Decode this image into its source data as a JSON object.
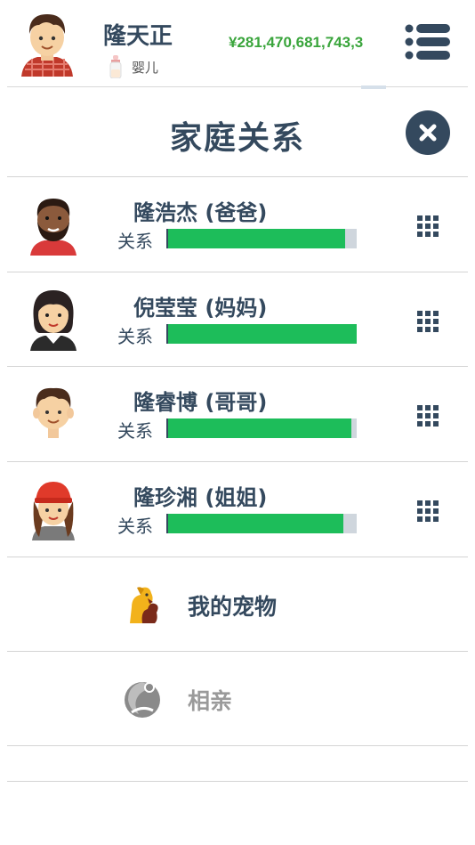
{
  "player": {
    "name": "隆天正",
    "stage": "婴儿",
    "money": "¥281,470,681,743,3"
  },
  "page": {
    "title": "家庭关系"
  },
  "relation_label": "关系",
  "members": [
    {
      "name": "隆浩杰 (爸爸)",
      "relation": 0.94
    },
    {
      "name": "倪莹莹 (妈妈)",
      "relation": 1.0
    },
    {
      "name": "隆睿博 (哥哥)",
      "relation": 0.97
    },
    {
      "name": "隆珍湘 (姐姐)",
      "relation": 0.93
    }
  ],
  "features": {
    "pets": {
      "label": "我的宠物",
      "color": "#34495e"
    },
    "dating": {
      "label": "相亲",
      "color": "#9a9a9a"
    }
  },
  "colors": {
    "text": "#34495e",
    "money": "#3aa53c",
    "bar_fill": "#1dbd5a",
    "bar_bg": "#cfd6dd"
  }
}
